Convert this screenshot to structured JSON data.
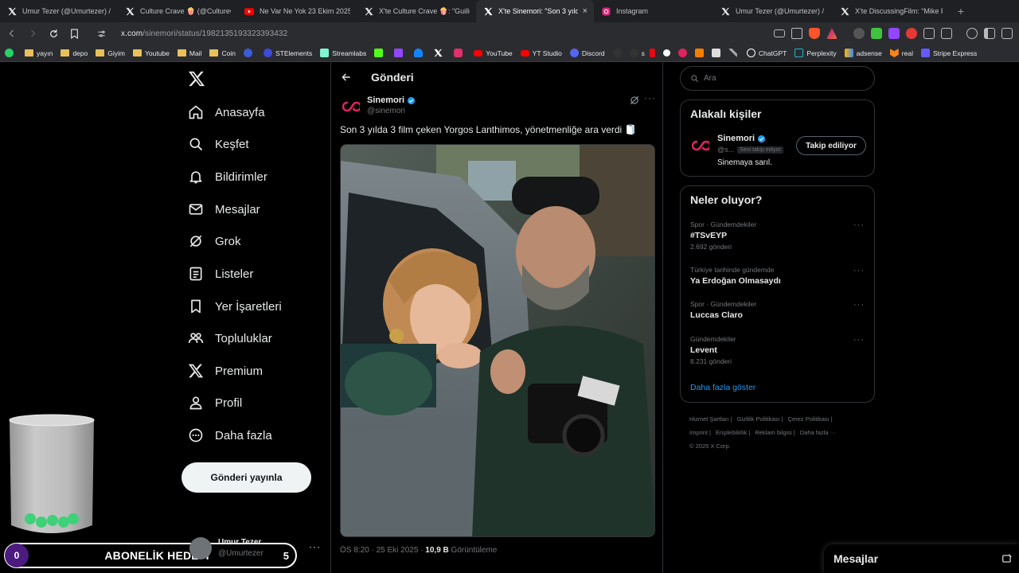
{
  "browser": {
    "tabs": [
      {
        "label": "Umur Tezer (@Umurtezer) / X",
        "icon": "x-icon",
        "active": false
      },
      {
        "label": "Culture Crave 🍿 (@CultureCra",
        "icon": "x-icon",
        "active": false
      },
      {
        "label": "Ne Var Ne Yok 23 Ekim 2025 /",
        "icon": "youtube-icon",
        "active": false
      },
      {
        "label": "X'te Culture Crave 🍿: \"Guiller",
        "icon": "x-icon",
        "active": false
      },
      {
        "label": "X'te Sinemori: \"Son 3 yılda",
        "icon": "x-icon",
        "active": true
      },
      {
        "label": "Instagram",
        "icon": "instagram-icon",
        "active": false
      },
      {
        "label": "Umur Tezer (@Umurtezer) / X",
        "icon": "x-icon",
        "active": false
      },
      {
        "label": "X'te DiscussingFilm: \"Mike Fla",
        "icon": "x-icon",
        "active": false
      }
    ],
    "tab_close": "×",
    "new_tab": "+",
    "url_host": "x.com",
    "url_path": "/sinemori/status/1982135193323393432",
    "bookmarks": [
      {
        "label": "",
        "icon": "whatsapp-icon",
        "color": "#25d366"
      },
      {
        "label": "yayın",
        "icon": "folder-icon",
        "color": "#e8c15a"
      },
      {
        "label": "depo",
        "icon": "folder-icon",
        "color": "#e8c15a"
      },
      {
        "label": "Giyim",
        "icon": "folder-icon",
        "color": "#e8c15a"
      },
      {
        "label": "Youtube",
        "icon": "folder-icon",
        "color": "#e8c15a"
      },
      {
        "label": "Mail",
        "icon": "folder-icon",
        "color": "#e8c15a"
      },
      {
        "label": "Coin",
        "icon": "folder-icon",
        "color": "#e8c15a"
      },
      {
        "label": "",
        "icon": "r-icon",
        "color": "#3b5bdb"
      },
      {
        "label": "STElements",
        "icon": "streamelements-icon",
        "color": "#3b4bd8"
      },
      {
        "label": "Streamlabs",
        "icon": "streamlabs-icon",
        "color": "#80f5d2"
      },
      {
        "label": "",
        "icon": "kick-icon",
        "color": "#53fc18"
      },
      {
        "label": "",
        "icon": "twitch-icon",
        "color": "#9146ff"
      },
      {
        "label": "",
        "icon": "bluesky-icon",
        "color": "#1185fe"
      },
      {
        "label": "",
        "icon": "x-icon",
        "color": "#ffffff"
      },
      {
        "label": "",
        "icon": "instagram-icon",
        "color": "#e1306c"
      },
      {
        "label": "YouTube",
        "icon": "youtube-icon",
        "color": "#ff0000"
      },
      {
        "label": "YT Studio",
        "icon": "youtube-studio-icon",
        "color": "#ff0000"
      },
      {
        "label": "Discord",
        "icon": "discord-icon",
        "color": "#5865f2"
      },
      {
        "label": "",
        "icon": "tiktok-icon",
        "color": "#ffffff"
      },
      {
        "label": "s",
        "icon": "tiktok-icon",
        "color": "#ffffff"
      },
      {
        "label": "",
        "icon": "netflix-icon",
        "color": "#e50914"
      },
      {
        "label": "",
        "icon": "circle-icon",
        "color": "#ffffff"
      },
      {
        "label": "",
        "icon": "app-icon",
        "color": "#e0245e"
      },
      {
        "label": "",
        "icon": "blogger-icon",
        "color": "#f57d00"
      },
      {
        "label": "",
        "icon": "amazon-icon",
        "color": "#ffffff"
      },
      {
        "label": "",
        "icon": "tool-icon",
        "color": "#cccccc"
      },
      {
        "label": "ChatGPT",
        "icon": "chatgpt-icon",
        "color": "#ffffff"
      },
      {
        "label": "Perplexity",
        "icon": "perplexity-icon",
        "color": "#20b8cd"
      },
      {
        "label": "adsense",
        "icon": "adsense-icon",
        "color": "#fbbc04"
      },
      {
        "label": "real",
        "icon": "fox-icon",
        "color": "#f6851b"
      },
      {
        "label": "Stripe Express",
        "icon": "stripe-icon",
        "color": "#635bff"
      }
    ]
  },
  "nav": {
    "items": [
      {
        "label": "Anasayfa",
        "icon": "home-icon"
      },
      {
        "label": "Keşfet",
        "icon": "search-icon"
      },
      {
        "label": "Bildirimler",
        "icon": "bell-icon"
      },
      {
        "label": "Mesajlar",
        "icon": "mail-icon"
      },
      {
        "label": "Grok",
        "icon": "grok-icon"
      },
      {
        "label": "Listeler",
        "icon": "list-icon"
      },
      {
        "label": "Yer İşaretleri",
        "icon": "bookmark-icon"
      },
      {
        "label": "Topluluklar",
        "icon": "communities-icon"
      },
      {
        "label": "Premium",
        "icon": "x-icon"
      },
      {
        "label": "Profil",
        "icon": "profile-icon"
      },
      {
        "label": "Daha fazla",
        "icon": "more-circle-icon"
      }
    ],
    "post_button": "Gönderi yayınla"
  },
  "post": {
    "header": "Gönderi",
    "author_name": "Sinemori",
    "author_handle": "@sinemori",
    "text": "Son 3 yılda 3 film çeken Yorgos Lanthimos, yönetmenliğe ara verdi 🧻",
    "time": "ÖS 8:20 · 25 Eki 2025 ·",
    "views_count": "10,9 B",
    "views_label": "Görüntüleme",
    "more": "···"
  },
  "sidebar": {
    "search_placeholder": "Ara",
    "related": {
      "title": "Alakalı kişiler",
      "name": "Sinemori",
      "handle": "@s...",
      "follows_you": "Seni takip ediyor",
      "bio": "Sinemaya sarıl.",
      "follow_button": "Takip ediliyor"
    },
    "trends_title": "Neler oluyor?",
    "trends": [
      {
        "category": "Spor · Gündemdekiler",
        "name": "#TSvEYP",
        "count": "2.692 gönderi"
      },
      {
        "category": "Türkiye tarihinde gündemde",
        "name": "Ya Erdoğan Olmasaydı",
        "count": ""
      },
      {
        "category": "Spor · Gündemdekiler",
        "name": "Luccas Claro",
        "count": ""
      },
      {
        "category": "Gündemdekiler",
        "name": "Levent",
        "count": "8.231 gönderi"
      }
    ],
    "trend_more": "···",
    "show_more": "Daha fazla göster",
    "footer_links": [
      "Hizmet Şartları |",
      "Gizlilik Politikası |",
      "Çerez Politikası |",
      "Imprint |",
      "Erişilebilirlik |",
      "Reklam bilgisi |",
      "Daha fazla ···",
      "© 2025 X Corp."
    ]
  },
  "account": {
    "name": "Umur Tezer",
    "handle": "@Umurtezer",
    "more": "···"
  },
  "overlay": {
    "goal_start": "0",
    "goal_label": "ABONELİK HEDEFİ",
    "goal_end": "5"
  },
  "messages_drawer": {
    "title": "Mesajlar"
  },
  "colors": {
    "accent": "#1d9bf0",
    "verified": "#1d9bf0",
    "brand_red": "#e0245e",
    "goal_purple": "#4b1b80"
  }
}
